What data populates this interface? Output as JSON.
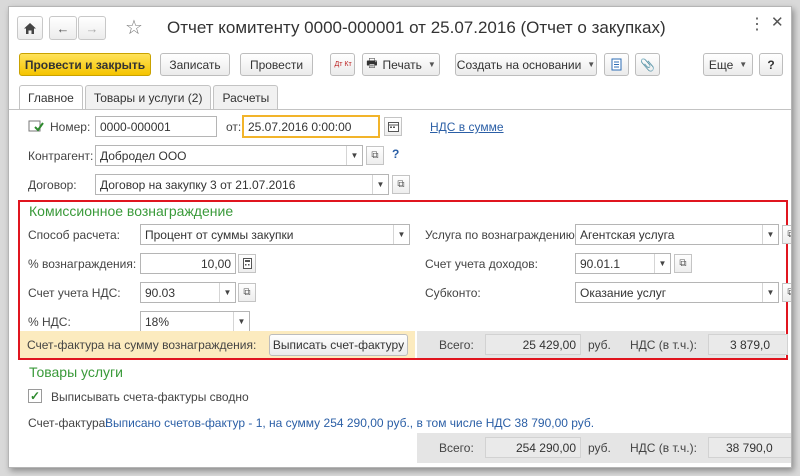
{
  "window": {
    "title": "Отчет комитенту 0000-000001 от 25.07.2016 (Отчет о закупках)",
    "icons": [
      "home-icon",
      "back-arrow-icon",
      "forward-arrow-icon",
      "star-icon",
      "menu-dots-icon",
      "close-icon"
    ]
  },
  "toolbar": {
    "post_close": "Провести и закрыть",
    "save": "Записать",
    "post": "Провести",
    "dt_kt": "Дт Кт",
    "print": "Печать",
    "create_based": "Создать на основании",
    "more": "Еще",
    "help": "?"
  },
  "tabs": [
    "Главное",
    "Товары и услуги (2)",
    "Расчеты"
  ],
  "header": {
    "number_label": "Номер:",
    "number_value": "0000-000001",
    "date_label": "от:",
    "date_value": "25.07.2016  0:00:00",
    "vat_link": "НДС в сумме",
    "contractor_label": "Контрагент:",
    "contractor_value": "Добродел ООО",
    "contractor_help": "?",
    "contract_label": "Договор:",
    "contract_value": "Договор на закупку 3 от 21.07.2016"
  },
  "commission": {
    "title": "Комиссионное вознаграждение",
    "calc_method_label": "Способ расчета:",
    "calc_method_value": "Процент от суммы закупки",
    "percent_label": "% вознаграждения:",
    "percent_value": "10,00",
    "vat_account_label": "Счет учета НДС:",
    "vat_account_value": "90.03",
    "vat_rate_label": "% НДС:",
    "vat_rate_value": "18%",
    "service_label": "Услуга по вознаграждению:",
    "service_value": "Агентская услуга",
    "income_account_label": "Счет учета доходов:",
    "income_account_value": "90.01.1",
    "subconto_label": "Субконто:",
    "subconto_value": "Оказание услуг",
    "invoice_label": "Счет-фактура на сумму вознаграждения:",
    "invoice_button": "Выписать счет-фактуру",
    "total_label": "Всего:",
    "total_value": "25 429,00",
    "currency": "руб.",
    "vat_incl_label": "НДС (в т.ч.):",
    "vat_incl_value": "3 879,0"
  },
  "goods": {
    "title": "Товары услуги",
    "summary_invoices_label": "Выписывать счета-фактуры сводно",
    "summary_invoices_checked": true,
    "invoice_label": "Счет-фактура:",
    "invoice_link": "Выписано счетов-фактур - 1, на сумму 254 290,00 руб., в том числе НДС 38 790,00 руб.",
    "total_label": "Всего:",
    "total_value": "254 290,00",
    "currency": "руб.",
    "vat_incl_label": "НДС (в т.ч.):",
    "vat_incl_value": "38 790,0"
  }
}
